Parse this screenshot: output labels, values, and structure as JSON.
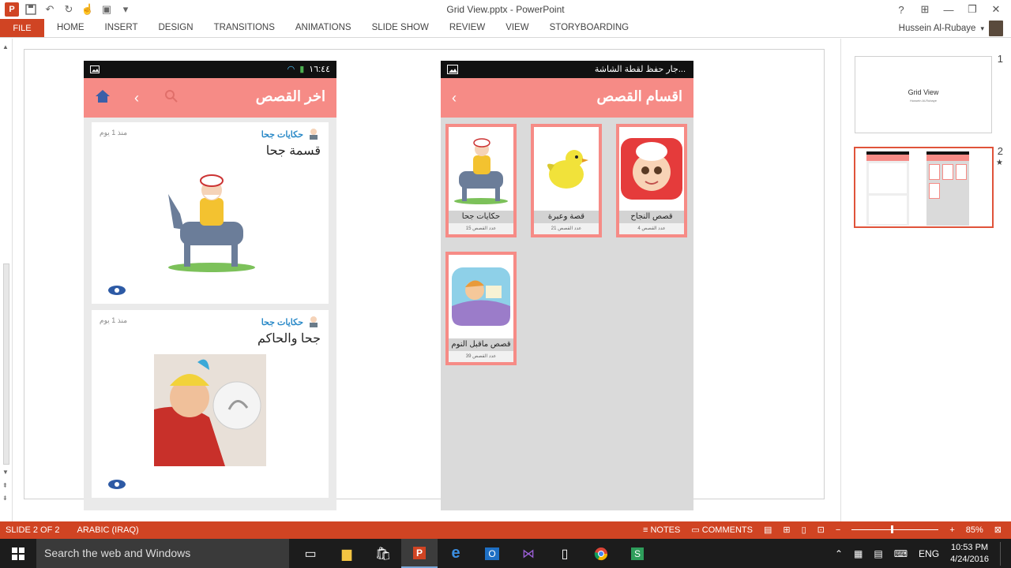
{
  "window": {
    "title": "Grid View.pptx - PowerPoint"
  },
  "ribbon": {
    "file_label": "FILE",
    "tabs": [
      "HOME",
      "INSERT",
      "DESIGN",
      "TRANSITIONS",
      "ANIMATIONS",
      "SLIDE SHOW",
      "REVIEW",
      "VIEW",
      "STORYBOARDING"
    ],
    "user_name": "Hussein Al-Rubaye"
  },
  "left_phone": {
    "clock": "١٦:٤٤",
    "appbar_title": "اخر القصص",
    "cards": [
      {
        "category": "حكايات جحا",
        "time": "منذ 1 يوم",
        "title": "قسمة جحا"
      },
      {
        "category": "حكايات جحا",
        "time": "منذ 1 يوم",
        "title": "جحا والحاكم"
      }
    ]
  },
  "right_phone": {
    "status_text": "جار حفظ لقطة الشاشة...",
    "appbar_title": "اقسام القصص",
    "tiles": [
      {
        "label": "قصص النجاح",
        "count": "عدد القصص 4"
      },
      {
        "label": "قصة وعبرة",
        "count": "عدد القصص 21"
      },
      {
        "label": "حكايات جحا",
        "count": "عدد القصص 15"
      },
      {
        "label": "قصص ماقبل النوم",
        "count": "عدد القصص 39"
      }
    ]
  },
  "thumbnails": {
    "slide1_num": "1",
    "slide1_title": "Grid View",
    "slide1_sub": "Hussein Al-Rubaye",
    "slide2_num": "2",
    "slide2_star": "★"
  },
  "statusbar": {
    "slide_info": "SLIDE 2 OF 2",
    "language": "ARABIC (IRAQ)",
    "notes_label": "NOTES",
    "comments_label": "COMMENTS",
    "zoom_percent": "85%",
    "zoom_level": 0.85
  },
  "taskbar": {
    "search_placeholder": "Search the web and Windows",
    "lang": "ENG",
    "time": "10:53 PM",
    "date": "4/24/2016"
  },
  "colors": {
    "office_accent": "#d04423",
    "app_pink": "#f68b86",
    "link_blue": "#2b8ac8"
  }
}
